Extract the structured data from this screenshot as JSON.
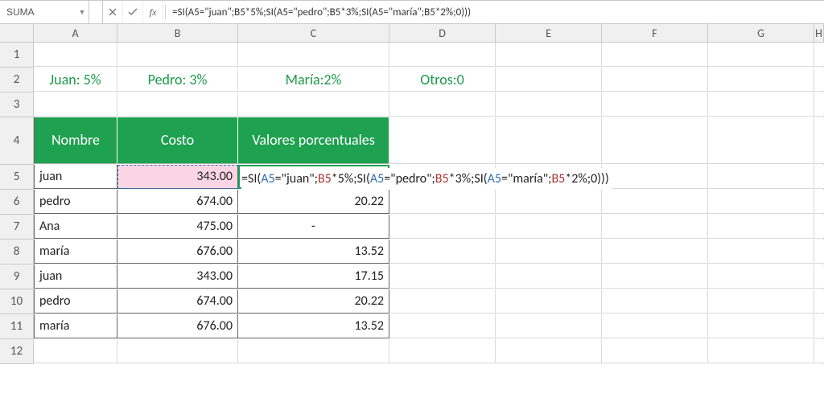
{
  "formula_bar": {
    "name_box": "SUMA",
    "fx_label": "fx",
    "formula_plain": "=SI(A5=\"juan\";B5*5%;SI(A5=\"pedro\";B5*3%;SI(A5=\"maría\";B5*2%;0)))"
  },
  "columns": [
    "A",
    "B",
    "C",
    "D",
    "E",
    "F",
    "G",
    "H"
  ],
  "row_numbers": [
    1,
    2,
    3,
    4,
    5,
    6,
    7,
    8,
    9,
    10,
    11,
    12
  ],
  "hints_row2": {
    "A": "Juan: 5%",
    "B": "Pedro: 3%",
    "C": "María:2%",
    "D": "Otros:0"
  },
  "headers_row4": {
    "A": "Nombre",
    "B": "Costo",
    "C": "Valores porcentuales"
  },
  "data_rows": [
    {
      "row": 5,
      "nombre": "juan",
      "costo": "343.00",
      "valor": ""
    },
    {
      "row": 6,
      "nombre": "pedro",
      "costo": "674.00",
      "valor": "20.22"
    },
    {
      "row": 7,
      "nombre": "Ana",
      "costo": "475.00",
      "valor": "-"
    },
    {
      "row": 8,
      "nombre": "maría",
      "costo": "676.00",
      "valor": "13.52"
    },
    {
      "row": 9,
      "nombre": "juan",
      "costo": "343.00",
      "valor": "17.15"
    },
    {
      "row": 10,
      "nombre": "pedro",
      "costo": "674.00",
      "valor": "20.22"
    },
    {
      "row": 11,
      "nombre": "maría",
      "costo": "676.00",
      "valor": "13.52"
    }
  ],
  "editing": {
    "cell": "C5",
    "ref_highlight": "B5",
    "tokens": [
      {
        "t": "=",
        "c": "tok-fn"
      },
      {
        "t": "SI(",
        "c": "tok-fn"
      },
      {
        "t": "A5",
        "c": "tok-ref"
      },
      {
        "t": "=\"juan\";",
        "c": "tok-fn"
      },
      {
        "t": "B5",
        "c": "tok-ref2"
      },
      {
        "t": "*5%;",
        "c": "tok-fn"
      },
      {
        "t": "SI(",
        "c": "tok-fn"
      },
      {
        "t": "A5",
        "c": "tok-ref"
      },
      {
        "t": "=\"pedro\";",
        "c": "tok-fn"
      },
      {
        "t": "B5",
        "c": "tok-ref2"
      },
      {
        "t": "*3%;",
        "c": "tok-fn"
      },
      {
        "t": "SI(",
        "c": "tok-fn"
      },
      {
        "t": "A5",
        "c": "tok-ref"
      },
      {
        "t": "=\"maría\";",
        "c": "tok-fn"
      },
      {
        "t": "B5",
        "c": "tok-ref2"
      },
      {
        "t": "*2%;0)))",
        "c": "tok-fn"
      }
    ]
  }
}
